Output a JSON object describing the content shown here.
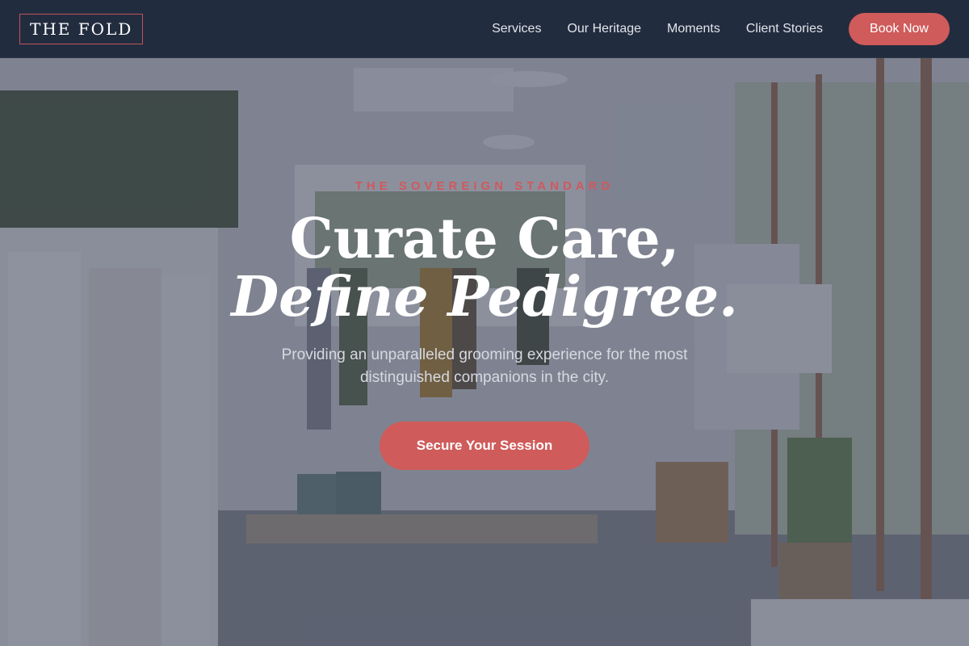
{
  "brand": {
    "logo_text": "THE FOLD"
  },
  "nav": {
    "items": [
      {
        "label": "Services"
      },
      {
        "label": "Our Heritage"
      },
      {
        "label": "Moments"
      },
      {
        "label": "Client Stories"
      }
    ],
    "cta_label": "Book Now"
  },
  "hero": {
    "eyebrow": "THE SOVEREIGN STANDARD",
    "headline_line1": "Curate Care,",
    "headline_line2": "Define Pedigree.",
    "subtitle": "Providing an unparalleled grooming experience for the most distinguished companions in the city.",
    "cta_label": "Secure Your Session"
  },
  "colors": {
    "header_bg": "#222c3f",
    "accent": "#cf5b5b",
    "overlay": "#343c54"
  }
}
